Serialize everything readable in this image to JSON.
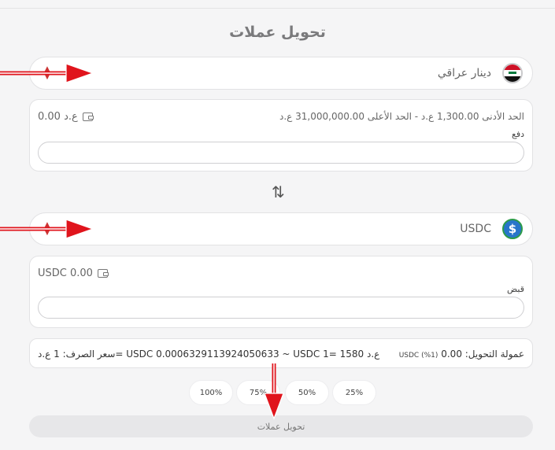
{
  "page": {
    "title": "تحويل عملات"
  },
  "from": {
    "currency_label": "دينار عراقي",
    "balance": "0.00 ع.د",
    "limits": "الحد الأدنى 1,300.00 ع.د   -   الحد الأعلى 31,000,000.00 ع.د",
    "field_label": "دفع",
    "input_value": ""
  },
  "to": {
    "currency_label": "USDC",
    "balance": "USDC 0.00",
    "field_label": "قبض",
    "input_value": ""
  },
  "summary": {
    "fee_label": "عمولة التحويل: 0.00",
    "fee_detail": "(1%) USDC",
    "rate": "سعر الصرف: 1 ع.د= USDC 0.0006329113924050633 ~ USDC 1= 1580 ع.د"
  },
  "percent_buttons": [
    "25%",
    "50%",
    "75%",
    "100%"
  ],
  "submit_label": "تحويل عملات",
  "icons": {
    "flag": "iraq-flag-icon",
    "coin": "usdc-coin-icon",
    "wallet": "wallet-icon",
    "swap": "swap-arrows-icon"
  },
  "colors": {
    "background": "#f5f5f6",
    "annotation_arrow": "#e0141c"
  }
}
